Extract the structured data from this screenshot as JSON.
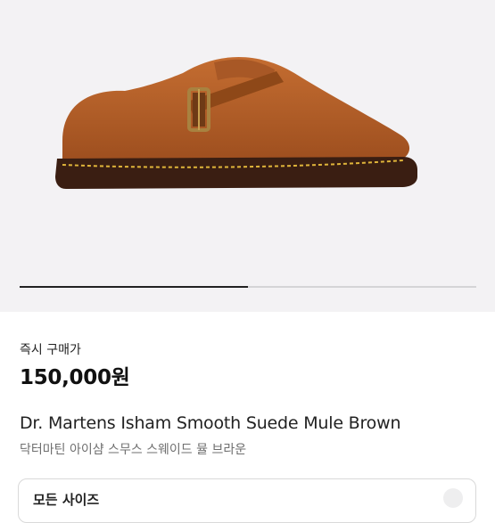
{
  "product": {
    "image_icon": "brown-suede-mule-shoe-image",
    "carousel_progress_fraction": 0.5,
    "price_label": "즉시 구매가",
    "price": "150,000원",
    "title_en": "Dr. Martens Isham Smooth Suede Mule Brown",
    "title_ko": "닥터마틴 아이샴 스무스 스웨이드 뮬 브라운"
  },
  "size_select": {
    "label": "모든 사이즈",
    "icon": "arrows-icon"
  },
  "colors": {
    "hero_bg": "#f3f2f4",
    "suede": "#b35f28",
    "sole": "#3a1e12",
    "stitch": "#e0b53a",
    "buckle": "#a88240"
  }
}
